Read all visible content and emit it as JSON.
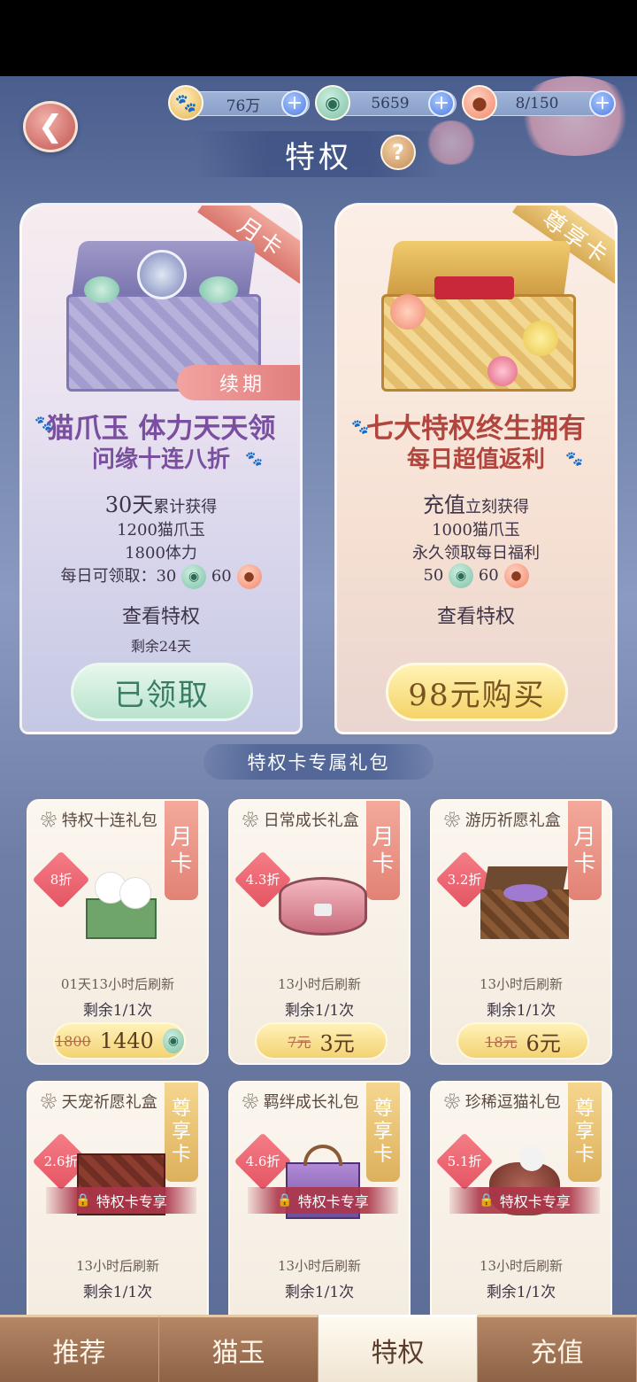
{
  "header": {
    "title": "特权",
    "currencies": [
      {
        "icon": "cat-paw-coin-icon",
        "value": "76万"
      },
      {
        "icon": "cat-jade-icon",
        "value": "5659"
      },
      {
        "icon": "stamina-bun-icon",
        "value": "8/150"
      }
    ]
  },
  "month_card": {
    "badge": "月卡",
    "renew_label": "续期",
    "slogan_line1": "猫爪玉 体力天天领",
    "slogan_line2": "问缘十连八折",
    "days_big": "30天",
    "days_small": "累计获得",
    "gain1": "1200猫爪玉",
    "gain2": "1800体力",
    "daily_label": "每日可领取：",
    "daily_jade": "30",
    "daily_stamina": "60",
    "view_label": "查看特权",
    "remaining": "剩余24天",
    "button_label": "已领取"
  },
  "vip_card": {
    "badge": "尊享卡",
    "slogan_line1": "七大特权终生拥有",
    "slogan_line2": "每日超值返利",
    "recharge_big": "充值",
    "recharge_small": "立刻获得",
    "gain1": "1000猫爪玉",
    "gain2": "永久领取每日福利",
    "daily_jade": "50",
    "daily_stamina": "60",
    "view_label": "查看特权",
    "button_label": "98元购买"
  },
  "section_title": "特权卡专属礼包",
  "packs": [
    {
      "title": "特权十连礼包",
      "ribbon": [
        "月",
        "卡"
      ],
      "discount": "8折",
      "refresh": "01天13小时后刷新",
      "remain": "剩余1/1次",
      "old_price": "1800",
      "new_price": "1440",
      "currency_icon": "jade"
    },
    {
      "title": "日常成长礼盒",
      "ribbon": [
        "月",
        "卡"
      ],
      "discount": "4.3折",
      "refresh": "13小时后刷新",
      "remain": "剩余1/1次",
      "old_price": "7元",
      "new_price": "3元"
    },
    {
      "title": "游历祈愿礼盒",
      "ribbon": [
        "月",
        "卡"
      ],
      "discount": "3.2折",
      "refresh": "13小时后刷新",
      "remain": "剩余1/1次",
      "old_price": "18元",
      "new_price": "6元"
    },
    {
      "title": "天宠祈愿礼盒",
      "ribbon": [
        "尊",
        "享",
        "卡"
      ],
      "discount": "2.6折",
      "exclusive": "特权卡专享",
      "refresh": "13小时后刷新",
      "remain": "剩余1/1次"
    },
    {
      "title": "羁绊成长礼包",
      "ribbon": [
        "尊",
        "享",
        "卡"
      ],
      "discount": "4.6折",
      "exclusive": "特权卡专享",
      "refresh": "13小时后刷新",
      "remain": "剩余1/1次"
    },
    {
      "title": "珍稀逗猫礼包",
      "ribbon": [
        "尊",
        "享",
        "卡"
      ],
      "discount": "5.1折",
      "exclusive": "特权卡专享",
      "refresh": "13小时后刷新",
      "remain": "剩余1/1次"
    }
  ],
  "tabs": [
    {
      "label": "推荐",
      "active": false
    },
    {
      "label": "猫玉",
      "active": false
    },
    {
      "label": "特权",
      "active": true
    },
    {
      "label": "充值",
      "active": false
    }
  ],
  "colors": {
    "accent_pink": "#e07c7c",
    "accent_gold": "#f5d469",
    "sky": "#6d7fa8"
  }
}
